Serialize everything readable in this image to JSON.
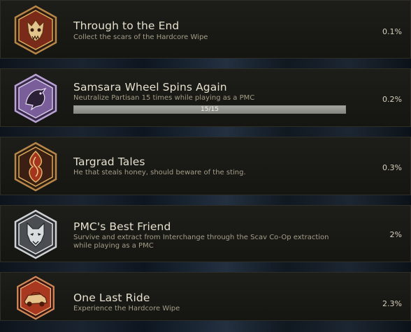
{
  "achievements": [
    {
      "title": "Through to the End",
      "description": "Collect the scars of the Hardcore Wipe",
      "percent": "0.1%",
      "badge_icon": "beast-skull-icon",
      "theme": "bronze-hexagon"
    },
    {
      "title": "Samsara Wheel Spins Again",
      "description": "Neutralize Partisan 15 times while playing as a PMC",
      "percent": "0.2%",
      "badge_icon": "raven-icon",
      "theme": "purple-hexagon",
      "progress": {
        "current": 15,
        "max": 15,
        "label": "15/15"
      }
    },
    {
      "title": "Targrad Tales",
      "description": "He that steals honey, should beware of the sting.",
      "percent": "0.3%",
      "badge_icon": "ornament-icon",
      "theme": "bronze-hexagon"
    },
    {
      "title": "PMC's Best Friend",
      "description": "Survive and extract from Interchange through the Scav Co-Op extraction while playing as a PMC",
      "percent": "2%",
      "badge_icon": "wolf-icon",
      "theme": "silver-hexagon"
    },
    {
      "title": "One Last Ride",
      "description": "Experience the Hardcore Wipe",
      "percent": "2.3%",
      "badge_icon": "wrecked-car-icon",
      "theme": "red-hexagon"
    }
  ],
  "colors": {
    "bronze": "#c9a15a",
    "purple": "#8e6fb0",
    "silver": "#c9c9c9",
    "red": "#b8412b"
  }
}
